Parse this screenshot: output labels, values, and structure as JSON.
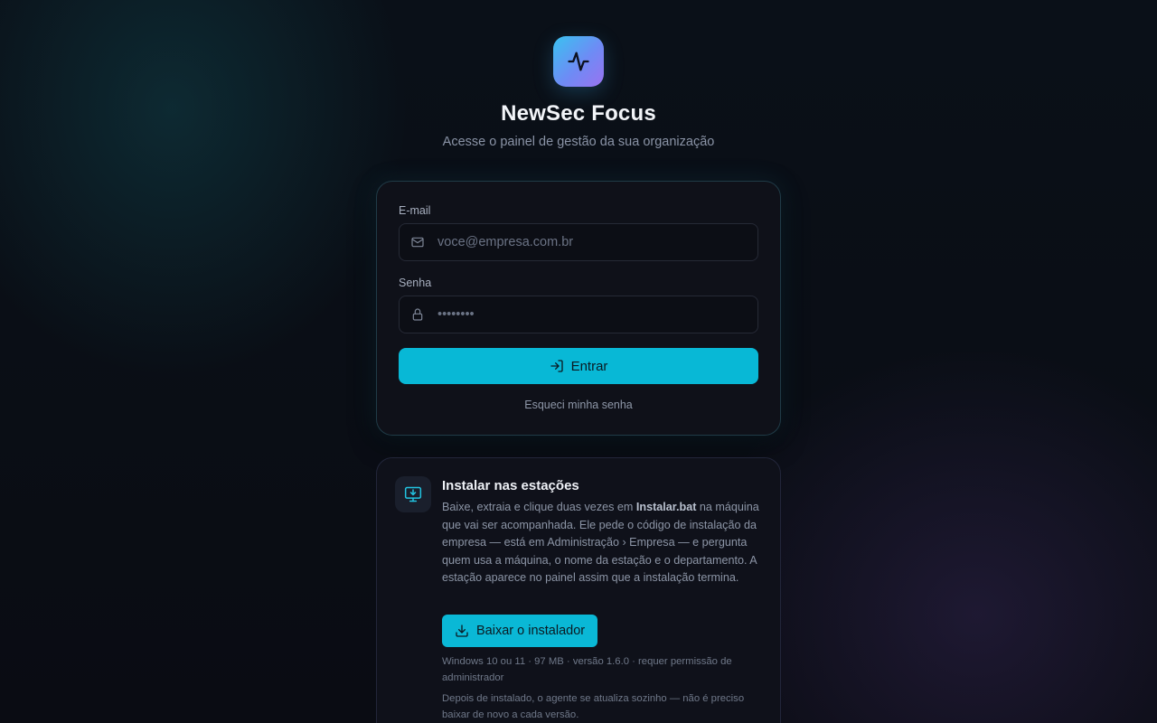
{
  "brand": {
    "title": "NewSec Focus",
    "subtitle": "Acesse o painel de gestão da sua organização",
    "logo_icon": "activity-pulse-icon",
    "logo_gradient": [
      "#39c3f0",
      "#9a72f0"
    ]
  },
  "login": {
    "email_label": "E-mail",
    "email_placeholder": "voce@empresa.com.br",
    "email_icon": "mail-icon",
    "password_label": "Senha",
    "password_placeholder": "••••••••",
    "password_icon": "lock-icon",
    "submit_label": "Entrar",
    "submit_icon": "log-in-icon",
    "forgot_label": "Esqueci minha senha"
  },
  "install": {
    "icon": "monitor-download-icon",
    "title": "Instalar nas estações",
    "desc_before": "Baixe, extraia e clique duas vezes em ",
    "desc_file": "Instalar.bat",
    "desc_after": " na máquina que vai ser acompanhada. Ele pede o código de instalação da empresa — está em Administração › Empresa — e pergunta quem usa a máquina, o nome da estação e o departamento. A estação aparece no painel assim que a instalação termina.",
    "download_label": "Baixar o instalador",
    "download_icon": "download-icon",
    "requirements": "Windows 10 ou 11 · 97 MB · versão 1.6.0 · requer permissão de administrador",
    "update_note": "Depois de instalado, o agente se atualiza sozinho — não é preciso baixar de novo a cada versão."
  },
  "colors": {
    "accent": "#08b8d6",
    "background": "#0a0d14",
    "card": "#0f1119"
  }
}
